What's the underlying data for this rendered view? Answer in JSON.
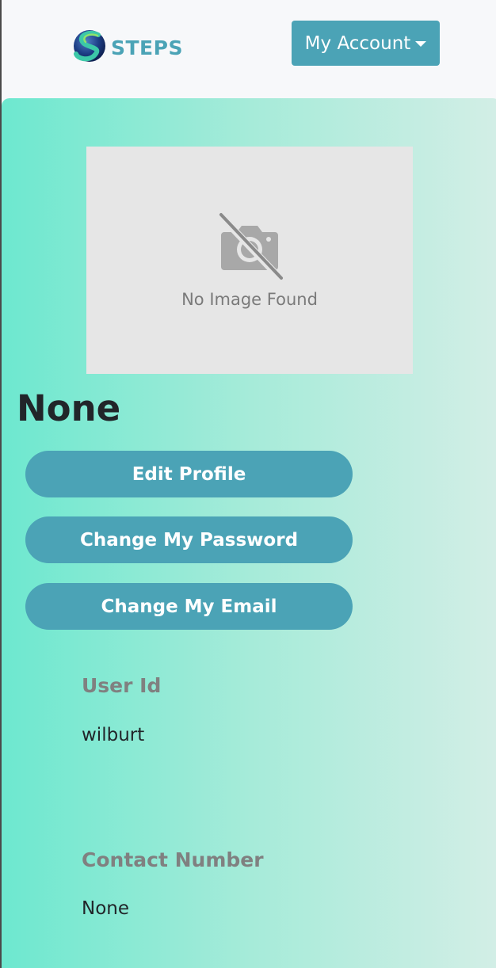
{
  "navbar": {
    "brand_name": "STEPS",
    "logo_icon": "steps-globe-logo",
    "account_menu_label": "My Account"
  },
  "profile": {
    "photo_placeholder_text": "No Image Found",
    "photo_icon": "no-camera-icon",
    "name": "None"
  },
  "actions": {
    "edit_profile": "Edit Profile",
    "change_password": "Change My Password",
    "change_email": "Change My Email"
  },
  "details": {
    "user_id_label": "User Id",
    "user_id_value": "wilburt",
    "contact_label": "Contact Number",
    "contact_value": "None"
  },
  "colors": {
    "accent": "#4ba3b6",
    "gradient_start": "#6de8cf",
    "gradient_end": "#d3eee6",
    "label_gray": "#808080"
  }
}
